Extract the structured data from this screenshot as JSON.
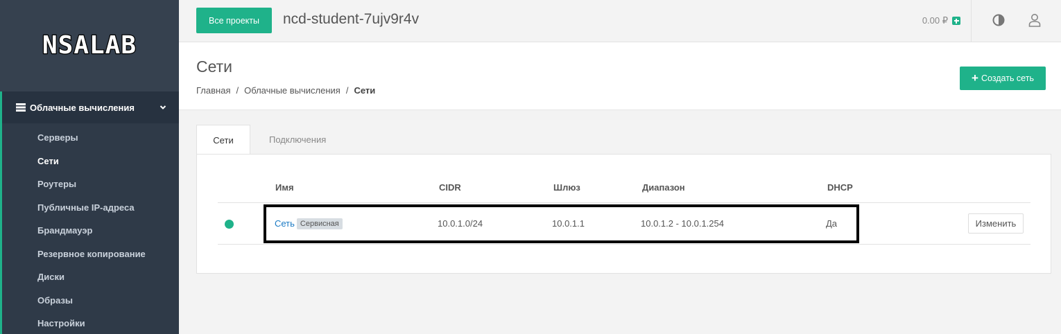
{
  "sidebar": {
    "logo_text": "NSALAB",
    "section_label": "Облачные вычисления",
    "items": [
      {
        "label": "Серверы",
        "active": false
      },
      {
        "label": "Сети",
        "active": true
      },
      {
        "label": "Роутеры",
        "active": false
      },
      {
        "label": "Публичные IP-адреса",
        "active": false
      },
      {
        "label": "Брандмауэр",
        "active": false
      },
      {
        "label": "Резервное копирование",
        "active": false
      },
      {
        "label": "Диски",
        "active": false
      },
      {
        "label": "Образы",
        "active": false
      },
      {
        "label": "Настройки",
        "active": false
      }
    ]
  },
  "topbar": {
    "all_projects_label": "Все проекты",
    "project_name": "ncd-student-7ujv9r4v",
    "balance": "0.00 ₽"
  },
  "header": {
    "title": "Сети",
    "breadcrumb": [
      "Главная",
      "/",
      "Облачные вычисления",
      "/",
      "Сети"
    ],
    "create_label": "Создать сеть"
  },
  "tabs": [
    {
      "label": "Сети",
      "active": true
    },
    {
      "label": "Подключения",
      "active": false
    }
  ],
  "table": {
    "columns": [
      "Имя",
      "CIDR",
      "Шлюз",
      "Диапазон",
      "DHCP"
    ],
    "rows": [
      {
        "name": "Сеть",
        "badge": "Сервисная",
        "cidr": "10.0.1.0/24",
        "gateway": "10.0.1.1",
        "range": "10.0.1.2 - 10.0.1.254",
        "dhcp": "Да",
        "status": "active",
        "edit_label": "Изменить"
      }
    ]
  },
  "colors": {
    "accent": "#1fb28a",
    "sidebar": "#2f3a48",
    "link": "#1a7ac4"
  }
}
